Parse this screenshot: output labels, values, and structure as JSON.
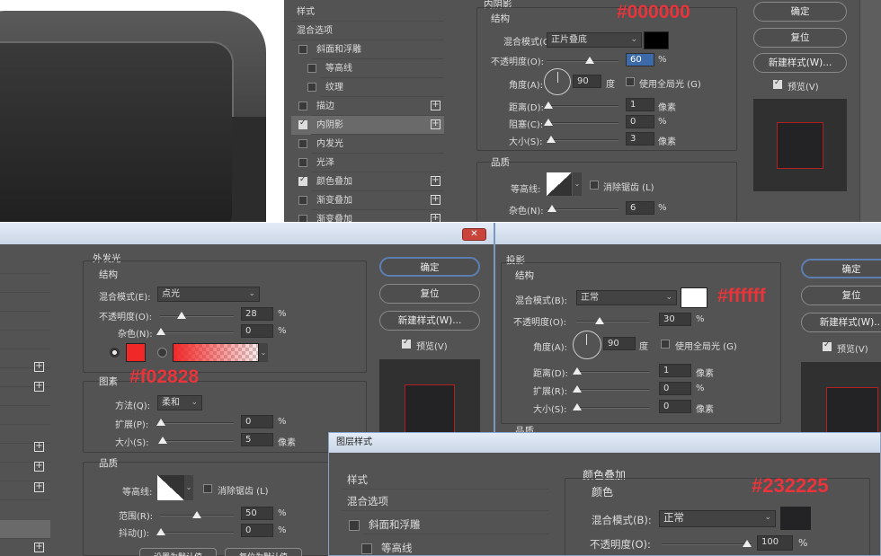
{
  "colors": {
    "black": "#000000",
    "white": "#ffffff",
    "red": "#f02828",
    "dark": "#232225"
  },
  "annotations": {
    "p1": "#000000",
    "p3": "#f02828",
    "p4": "#ffffff",
    "p5": "#232225"
  },
  "panel1": {
    "list": [
      "样式",
      "混合选项",
      "斜面和浮雕",
      "等高线",
      "纹理",
      "描边",
      "内阴影",
      "内发光",
      "光泽",
      "颜色叠加",
      "渐变叠加",
      "渐变叠加"
    ],
    "title": "内阴影",
    "struct": "结构",
    "blend_label": "混合模式(O):",
    "blend_value": "正片叠底",
    "opacity_label": "不透明度(O):",
    "opacity_value": "60",
    "pct": "%",
    "angle_label": "角度(A):",
    "angle_value": "90",
    "deg": "度",
    "global": "使用全局光 (G)",
    "dist_label": "距离(D):",
    "dist_value": "1",
    "px": "像素",
    "choke_label": "阻塞(C):",
    "choke_value": "0",
    "size_label": "大小(S):",
    "size_value": "3",
    "quality": "品质",
    "contour_label": "等高线:",
    "anti": "消除锯齿 (L)",
    "noise_label": "杂色(N):",
    "noise_value": "6",
    "ok": "确定",
    "reset": "复位",
    "newstyle": "新建样式(W)...",
    "preview": "预览(V)"
  },
  "panel3": {
    "title": "外发光",
    "struct": "结构",
    "blend_label": "混合模式(E):",
    "blend_value": "点光",
    "opacity_label": "不透明度(O):",
    "opacity_value": "28",
    "pct": "%",
    "noise_label": "杂色(N):",
    "noise_value": "0",
    "elements": "图素",
    "method_label": "方法(Q):",
    "method_value": "柔和",
    "spread_label": "扩展(P):",
    "spread_value": "0",
    "size_label": "大小(S):",
    "size_value": "5",
    "px": "像素",
    "quality": "品质",
    "contour_label": "等高线:",
    "anti": "消除锯齿 (L)",
    "range_label": "范围(R):",
    "range_value": "50",
    "jitter_label": "抖动(J):",
    "jitter_value": "0",
    "ok": "确定",
    "reset": "复位",
    "newstyle": "新建样式(W)...",
    "preview": "预览(V)",
    "bottom1": "设置为默认值",
    "bottom2": "复位为默认值"
  },
  "panel4": {
    "title": "投影",
    "struct": "结构",
    "blend_label": "混合模式(B):",
    "blend_value": "正常",
    "opacity_label": "不透明度(O):",
    "opacity_value": "30",
    "pct": "%",
    "angle_label": "角度(A):",
    "angle_value": "90",
    "deg": "度",
    "global": "使用全局光 (G)",
    "dist_label": "距离(D):",
    "dist_value": "1",
    "px": "像素",
    "spread_label": "扩展(R):",
    "spread_value": "0",
    "size_label": "大小(S):",
    "size_value": "0",
    "quality": "品质",
    "ok": "确定",
    "reset": "复位",
    "newstyle": "新建样式(W)...",
    "preview": "预览(V)"
  },
  "panel5": {
    "window_title": "图层样式",
    "list": [
      "样式",
      "混合选项",
      "斜面和浮雕",
      "等高线"
    ],
    "title": "颜色叠加",
    "sub": "颜色",
    "blend_label": "混合模式(B):",
    "blend_value": "正常",
    "opacity_label": "不透明度(O):",
    "opacity_value": "100",
    "pct": "%"
  }
}
